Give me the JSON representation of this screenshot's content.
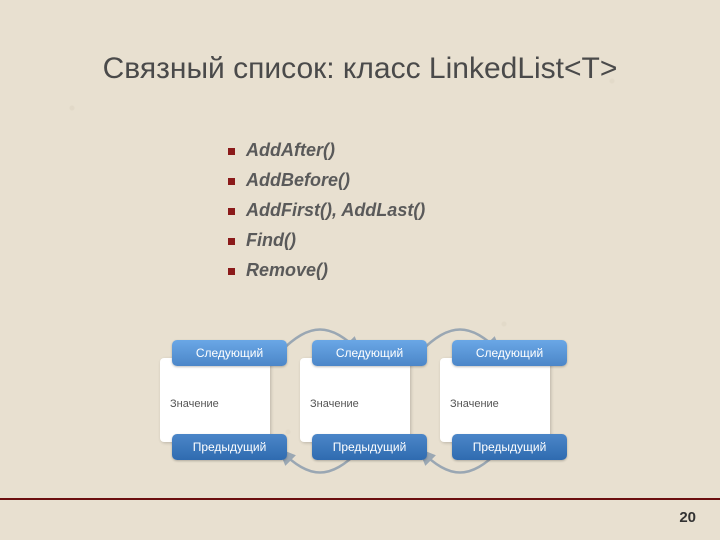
{
  "title": "Связный список: класс LinkedList<T>",
  "bullets": [
    "AddAfter()",
    "AddBefore()",
    "AddFirst(), AddLast()",
    "Find()",
    "Remove()"
  ],
  "diagram": {
    "top_label": "Следующий",
    "value_label": "Значение",
    "bottom_label": "Предыдущий"
  },
  "page_number": "20",
  "colors": {
    "bullet_marker": "#8b1a1a",
    "node_blue_light": "#6aa7e6",
    "node_blue_dark": "#2f6bb0",
    "rule": "#6b0f0f"
  }
}
